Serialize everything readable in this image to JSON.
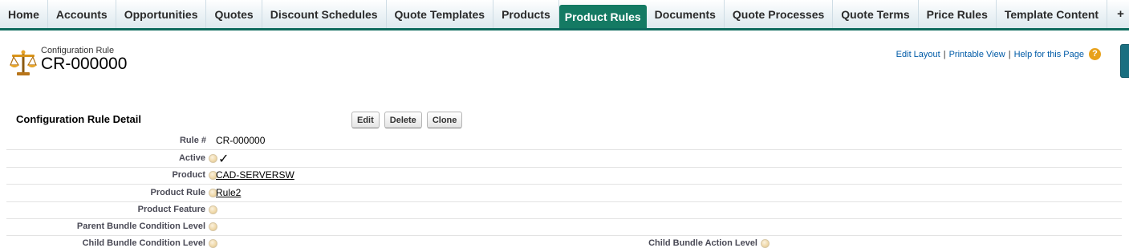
{
  "tabs": [
    {
      "label": "Home"
    },
    {
      "label": "Accounts"
    },
    {
      "label": "Opportunities"
    },
    {
      "label": "Quotes"
    },
    {
      "label": "Discount Schedules"
    },
    {
      "label": "Quote Templates"
    },
    {
      "label": "Products"
    },
    {
      "label": "Product Rules",
      "active": true
    },
    {
      "label": "Documents"
    },
    {
      "label": "Quote Processes"
    },
    {
      "label": "Quote Terms"
    },
    {
      "label": "Price Rules"
    },
    {
      "label": "Template Content"
    }
  ],
  "tab_extras": {
    "add_icon": "+",
    "menu_icon": "▼"
  },
  "header": {
    "record_type": "Configuration Rule",
    "record_name": "CR-000000",
    "links": {
      "edit_layout": "Edit Layout",
      "printable_view": "Printable View",
      "help": "Help for this Page",
      "separator": "|"
    },
    "help_icon": "?"
  },
  "detail": {
    "title": "Configuration Rule Detail",
    "buttons": {
      "edit": "Edit",
      "delete": "Delete",
      "clone": "Clone"
    },
    "fields": {
      "rule_number": {
        "label": "Rule #",
        "value": "CR-000000"
      },
      "active": {
        "label": "Active",
        "checked": true,
        "mark": "✓"
      },
      "product": {
        "label": "Product",
        "value": "CAD-SERVERSW"
      },
      "product_rule": {
        "label": "Product Rule",
        "value": "Rule2"
      },
      "product_feature": {
        "label": "Product Feature",
        "value": ""
      },
      "parent_bundle_condition_level": {
        "label": "Parent Bundle Condition Level",
        "value": ""
      },
      "child_bundle_condition_level": {
        "label": "Child Bundle Condition Level",
        "value": ""
      },
      "child_bundle_action_level": {
        "label": "Child Bundle Action Level",
        "value": ""
      }
    }
  },
  "colors": {
    "accent": "#147a63",
    "link": "#015ba7",
    "tab_border": "#0e6b5e"
  }
}
